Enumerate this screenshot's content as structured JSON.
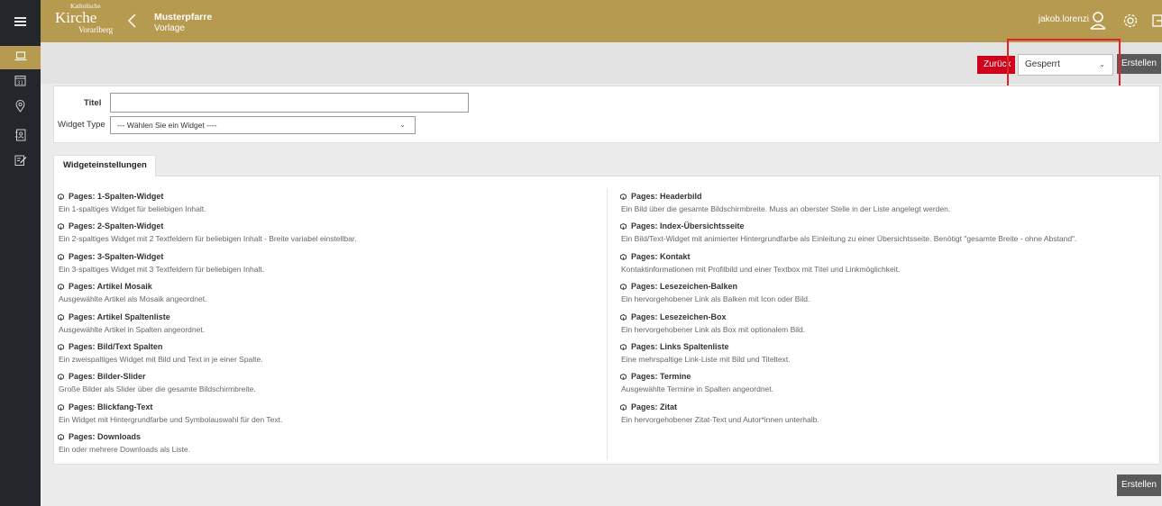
{
  "header": {
    "logo": {
      "line1": "Katholische",
      "line2": "Kirche",
      "line3": "Vorarlberg"
    },
    "title": "Musterpfarre",
    "subtitle": "Vorlage",
    "username": "jakob.lorenzi"
  },
  "sidebar": {
    "items": [
      {
        "icon": "laptop-icon",
        "active": true
      },
      {
        "icon": "calendar-icon",
        "label": "31"
      },
      {
        "icon": "location-pin-icon"
      },
      {
        "icon": "contacts-icon"
      },
      {
        "icon": "edit-note-icon"
      }
    ]
  },
  "toolbar": {
    "back_label": "Zurück",
    "status_value": "Gesperrt",
    "create_label": "Erstellen"
  },
  "form": {
    "titel_label": "Titel",
    "titel_value": "",
    "widget_type_label": "Widget Type",
    "widget_type_value": "--- Wählen Sie ein Widget ----"
  },
  "tab": {
    "label": "Widgeteinstellungen"
  },
  "widgets_left": [
    {
      "title": "Pages: 1-Spalten-Widget",
      "desc": "Ein 1-spaltiges Widget für beliebigen Inhalt."
    },
    {
      "title": "Pages: 2-Spalten-Widget",
      "desc": "Ein 2-spaltiges Widget mit 2 Textfeldern für beliebigen Inhalt - Breite variabel einstellbar."
    },
    {
      "title": "Pages: 3-Spalten-Widget",
      "desc": "Ein 3-spaltiges Widget mit 3 Textfeldern für beliebigen Inhalt."
    },
    {
      "title": "Pages: Artikel Mosaik",
      "desc": "Ausgewählte Artikel als Mosaik angeordnet."
    },
    {
      "title": "Pages: Artikel Spaltenliste",
      "desc": "Ausgewählte Artikel in Spalten angeordnet."
    },
    {
      "title": "Pages: Bild/Text Spalten",
      "desc": "Ein zweispaltiges Widget mit Bild und Text in je einer Spalte."
    },
    {
      "title": "Pages: Bilder-Slider",
      "desc": "Große Bilder als Slider über die gesamte Bildschirmbreite."
    },
    {
      "title": "Pages: Blickfang-Text",
      "desc": "Ein Widget mit Hintergrundfarbe und Symbolauswahl für den Text."
    },
    {
      "title": "Pages: Downloads",
      "desc": "Ein oder mehrere Downloads als Liste."
    }
  ],
  "widgets_right": [
    {
      "title": "Pages: Headerbild",
      "desc": "Ein Bild über die gesamte Bildschirmbreite. Muss an oberster Stelle in der Liste angelegt werden."
    },
    {
      "title": "Pages: Index-Übersichtsseite",
      "desc": "Ein Bild/Text-Widget mit animierter Hintergrundfarbe als Einleitung zu einer Übersichtsseite. Benötigt \"gesamte Breite - ohne Abstand\"."
    },
    {
      "title": "Pages: Kontakt",
      "desc": "Kontaktinformationen mit Profilbild und einer Textbox mit Titel und Linkmöglichkeit."
    },
    {
      "title": "Pages: Lesezeichen-Balken",
      "desc": "Ein hervorgehobener Link als Balken mit Icon oder Bild."
    },
    {
      "title": "Pages: Lesezeichen-Box",
      "desc": "Ein hervorgehobener Link als Box mit optionalem Bild."
    },
    {
      "title": "Pages: Links Spaltenliste",
      "desc": "Eine mehrspaltige Link-Liste mit Bild und Titeltext."
    },
    {
      "title": "Pages: Termine",
      "desc": "Ausgewählte Termine in Spalten angeordnet."
    },
    {
      "title": "Pages: Zitat",
      "desc": "Ein hervorgehobener Zitat-Text und Autor*innen unterhalb."
    }
  ],
  "colors": {
    "brand_gold": "#b59a4f",
    "sidebar_dark": "#23262b",
    "back_red": "#d0021b",
    "create_gray": "#5a5a5a",
    "highlight_red": "#e0232b"
  }
}
